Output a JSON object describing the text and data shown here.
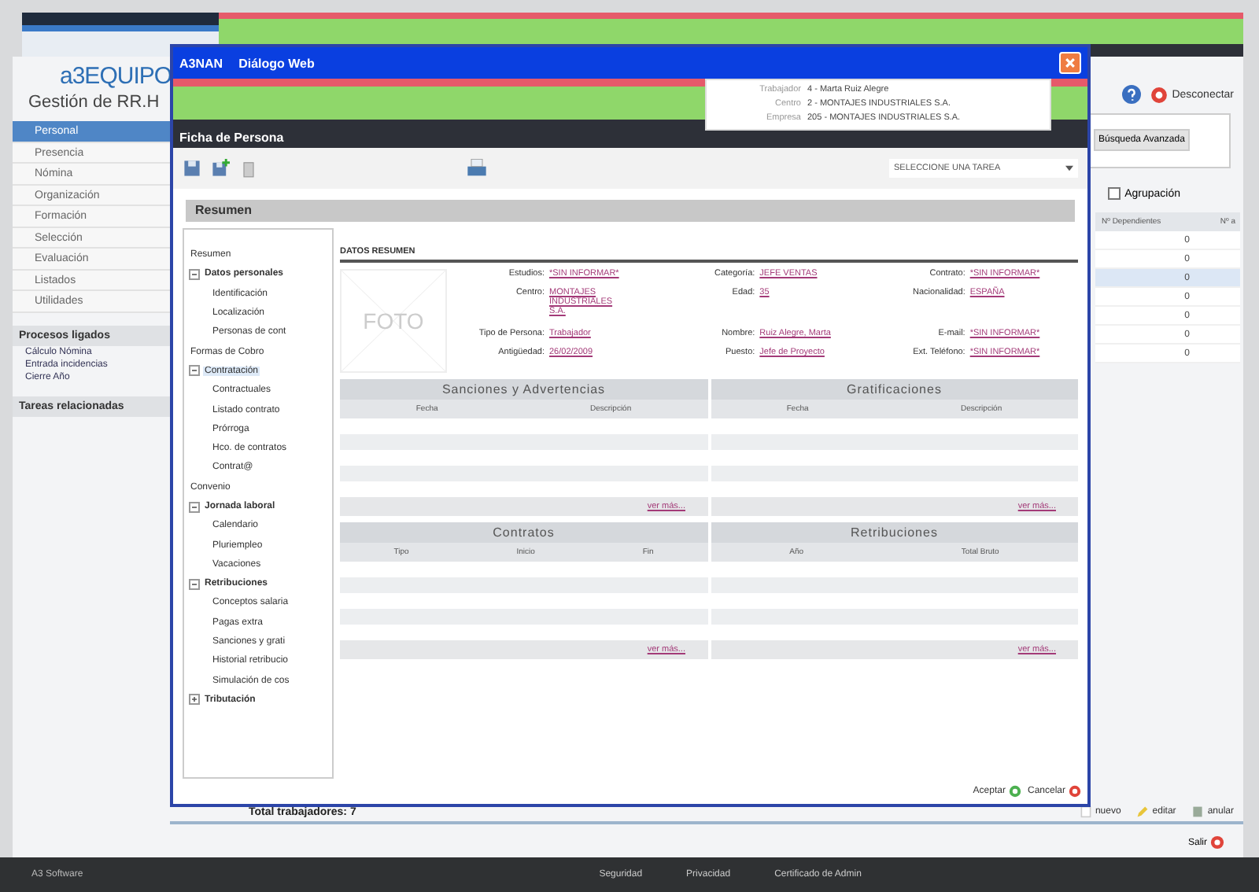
{
  "app": {
    "logo": "a3EQUIPO",
    "subtitle": "Gestión de RR.H",
    "menu": [
      {
        "label": "Personal",
        "selected": true
      },
      {
        "label": "Presencia",
        "selected": false
      },
      {
        "label": "Nómina",
        "selected": false
      },
      {
        "label": "Organización",
        "selected": false
      },
      {
        "label": "Formación",
        "selected": false
      },
      {
        "label": "Selección",
        "selected": false
      },
      {
        "label": "Evaluación",
        "selected": false
      },
      {
        "label": "Listados",
        "selected": false
      },
      {
        "label": "Utilidades",
        "selected": false
      }
    ],
    "processes": {
      "title": "Procesos ligados",
      "items": [
        "Cálculo Nómina",
        "Entrada incidencias",
        "Cierre Año"
      ]
    },
    "tasks_title": "Tareas relacionadas",
    "logout": "Desconectar",
    "advanced_search": "Búsqueda Avanzada",
    "grouping": {
      "label": "Agrupación",
      "checked": false
    },
    "table": {
      "columns": [
        "Nº Dependientes",
        "Nº a"
      ],
      "rows": [
        {
          "cells": [
            "0"
          ],
          "selected": false
        },
        {
          "cells": [
            "0"
          ],
          "selected": false
        },
        {
          "cells": [
            "0"
          ],
          "selected": true
        },
        {
          "cells": [
            "0"
          ],
          "selected": false
        },
        {
          "cells": [
            "0"
          ],
          "selected": false
        },
        {
          "cells": [
            "0"
          ],
          "selected": false
        },
        {
          "cells": [
            "0"
          ],
          "selected": false
        }
      ]
    },
    "total": "Total trabajadores: 7",
    "actions": [
      {
        "kind": "new",
        "label": "nuevo"
      },
      {
        "kind": "edit",
        "label": "editar"
      },
      {
        "kind": "cancel",
        "label": "anular"
      }
    ],
    "exit": "Salir",
    "footer": {
      "brand": "A3 Software",
      "links": [
        "Seguridad",
        "Privacidad",
        "Certificado de Admin"
      ]
    }
  },
  "dialog": {
    "app": "A3NAN",
    "title": "Diálogo Web",
    "context": [
      {
        "label": "Trabajador",
        "value": "4 - Marta Ruiz Alegre"
      },
      {
        "label": "Centro",
        "value": "2 - MONTAJES INDUSTRIALES S.A."
      },
      {
        "label": "Empresa",
        "value": "205 - MONTAJES INDUSTRIALES S.A."
      }
    ],
    "form_title": "Ficha de Persona",
    "task_select": "SELECCIONE UNA TAREA",
    "section": "Resumen",
    "tree": [
      {
        "label": "Resumen",
        "bold": false,
        "selected": false
      },
      {
        "label": "Datos personales",
        "bold": true,
        "expanded": true,
        "selected": false,
        "children": [
          {
            "label": "Identificación",
            "selected": false
          },
          {
            "label": "Localización",
            "selected": false
          },
          {
            "label": "Personas de cont",
            "selected": false
          }
        ]
      },
      {
        "label": "Formas de Cobro",
        "bold": false,
        "selected": false
      },
      {
        "label": "Contratación",
        "bold": false,
        "expanded": true,
        "selected": true,
        "children": [
          {
            "label": "Contractuales",
            "selected": false
          },
          {
            "label": "Listado contrato",
            "selected": false
          },
          {
            "label": "Prórroga",
            "selected": false
          },
          {
            "label": "Hco. de contratos",
            "selected": false
          },
          {
            "label": "Contrat@",
            "selected": false
          }
        ]
      },
      {
        "label": "Convenio",
        "bold": false,
        "selected": false
      },
      {
        "label": "Jornada laboral",
        "bold": true,
        "expanded": true,
        "selected": false,
        "children": [
          {
            "label": "Calendario",
            "selected": false
          },
          {
            "label": "Pluriempleo",
            "selected": false
          },
          {
            "label": "Vacaciones",
            "selected": false
          }
        ]
      },
      {
        "label": "Retribuciones",
        "bold": true,
        "expanded": true,
        "selected": false,
        "children": [
          {
            "label": "Conceptos salaria",
            "selected": false
          },
          {
            "label": "Pagas extra",
            "selected": false
          },
          {
            "label": "Sanciones y grati",
            "selected": false
          },
          {
            "label": "Historial retribucio",
            "selected": false
          },
          {
            "label": "Simulación de cos",
            "selected": false
          }
        ]
      },
      {
        "label": "Tributación",
        "bold": true,
        "expanded": false,
        "selected": false
      }
    ],
    "summary_title": "DATOS RESUMEN",
    "photo": "FOTO",
    "fields": [
      [
        {
          "label": "Estudios:",
          "value": "*SIN INFORMAR*"
        },
        {
          "label": "Centro:",
          "value": "MONTAJES INDUSTRIALES S.A."
        },
        {
          "label": "Tipo de Persona:",
          "value": "Trabajador"
        },
        {
          "label": "Antigüedad:",
          "value": "26/02/2009"
        }
      ],
      [
        {
          "label": "Categoría:",
          "value": "JEFE VENTAS"
        },
        {
          "label": "Edad:",
          "value": "35"
        },
        {
          "label": "Nombre:",
          "value": "Ruiz Alegre, Marta"
        },
        {
          "label": "Puesto:",
          "value": "Jefe de Proyecto"
        }
      ],
      [
        {
          "label": "Contrato:",
          "value": "*SIN INFORMAR*"
        },
        {
          "label": "Nacionalidad:",
          "value": "ESPAÑA"
        },
        {
          "label": "E-mail:",
          "value": "*SIN INFORMAR*"
        },
        {
          "label": "Ext. Teléfono:",
          "value": "*SIN INFORMAR*"
        }
      ]
    ],
    "panels": [
      {
        "title": "Sanciones y Advertencias",
        "columns": [
          "Fecha",
          "Descripción"
        ],
        "more": "ver más..."
      },
      {
        "title": "Gratificaciones",
        "columns": [
          "Fecha",
          "Descripción"
        ],
        "more": "ver más..."
      },
      {
        "title": "Contratos",
        "columns": [
          "Tipo",
          "Inicio",
          "Fin"
        ],
        "more": "ver más..."
      },
      {
        "title": "Retribuciones",
        "columns": [
          "Año",
          "Total Bruto"
        ],
        "more": "ver más..."
      }
    ],
    "ok": "Aceptar",
    "cancel": "Cancelar"
  }
}
